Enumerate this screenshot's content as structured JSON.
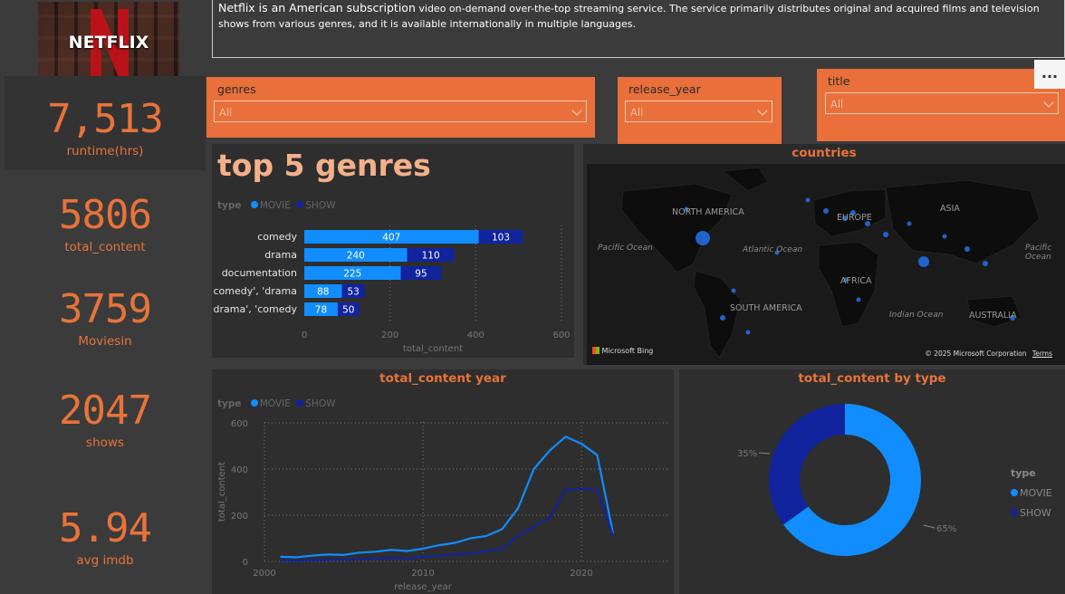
{
  "description": {
    "lead": "Netflix is an American subscription",
    "rest": " video on-demand over-the-top streaming service. The service primarily distributes original and acquired films and television shows from various genres, and it is available internationally in multiple languages."
  },
  "logo": {
    "text": "NETFLIX"
  },
  "kpis": [
    {
      "value": "7,513",
      "label": "runtime(hrs)"
    },
    {
      "value": "5806",
      "label": "total_content"
    },
    {
      "value": "3759",
      "label": "Moviesin"
    },
    {
      "value": "2047",
      "label": "shows"
    },
    {
      "value": "5.94",
      "label": "avg imdb"
    }
  ],
  "slicers": {
    "genres": {
      "title": "genres",
      "value": "All"
    },
    "release_year": {
      "title": "release_year",
      "value": "All"
    },
    "title": {
      "title": "title",
      "value": "All"
    }
  },
  "more_button": "...",
  "colors": {
    "accent": "#e8733a",
    "movie": "#118dff",
    "show": "#12239e",
    "panel": "#2e2e2e"
  },
  "top_genres": {
    "title": "top 5 genres",
    "legend": {
      "title": "type",
      "items": [
        "MOVIE",
        "SHOW"
      ]
    },
    "xlabel": "total_content",
    "ticks": [
      "0",
      "200",
      "400",
      "600"
    ]
  },
  "countries": {
    "title": "countries",
    "continents": [
      "NORTH AMERICA",
      "EUROPE",
      "ASIA",
      "AFRICA",
      "SOUTH AMERICA",
      "AUSTRALIA"
    ],
    "oceans": [
      "Pacific Ocean",
      "Atlantic Ocean",
      "Pacific Ocean",
      "Indian Ocean"
    ],
    "brand": "Microsoft Bing",
    "copyright": "© 2025 Microsoft Corporation",
    "terms": "Terms"
  },
  "year_chart": {
    "title": "total_content year",
    "legend": {
      "title": "type",
      "items": [
        "MOVIE",
        "SHOW"
      ]
    },
    "xlabel": "release_year",
    "ylabel": "total_content",
    "yticks": [
      "0",
      "200",
      "400",
      "600"
    ],
    "xticks": [
      "2000",
      "2010",
      "2020"
    ]
  },
  "donut": {
    "title": "total_content by type",
    "legend": {
      "title": "type",
      "items": [
        "MOVIE",
        "SHOW"
      ]
    },
    "labels": [
      "65%",
      "35%"
    ]
  },
  "chart_data": [
    {
      "type": "bar",
      "title": "top 5 genres",
      "categories": [
        "comedy",
        "drama",
        "documentation",
        "comedy', 'drama",
        "drama', 'comedy"
      ],
      "series": [
        {
          "name": "MOVIE",
          "values": [
            407,
            240,
            225,
            88,
            78
          ]
        },
        {
          "name": "SHOW",
          "values": [
            103,
            110,
            95,
            53,
            50
          ]
        }
      ],
      "stacked": true,
      "xlabel": "total_content",
      "xlim": [
        0,
        600
      ],
      "legend": "top-left"
    },
    {
      "type": "line",
      "title": "total_content year",
      "x": [
        2001,
        2002,
        2003,
        2004,
        2005,
        2006,
        2007,
        2008,
        2009,
        2010,
        2011,
        2012,
        2013,
        2014,
        2015,
        2016,
        2017,
        2018,
        2019,
        2020,
        2021,
        2022
      ],
      "series": [
        {
          "name": "MOVIE",
          "values": [
            20,
            18,
            25,
            30,
            28,
            38,
            42,
            50,
            45,
            55,
            70,
            80,
            100,
            110,
            140,
            230,
            400,
            480,
            540,
            510,
            460,
            120
          ]
        },
        {
          "name": "SHOW",
          "values": [
            5,
            4,
            5,
            6,
            8,
            10,
            12,
            15,
            12,
            20,
            25,
            30,
            35,
            45,
            55,
            110,
            150,
            190,
            310,
            315,
            310,
            110
          ]
        }
      ],
      "xlabel": "release_year",
      "ylabel": "total_content",
      "ylim": [
        0,
        600
      ],
      "legend": "top-left"
    },
    {
      "type": "pie",
      "title": "total_content by type",
      "categories": [
        "MOVIE",
        "SHOW"
      ],
      "values": [
        65,
        35
      ],
      "donut": true,
      "legend": "right"
    }
  ]
}
